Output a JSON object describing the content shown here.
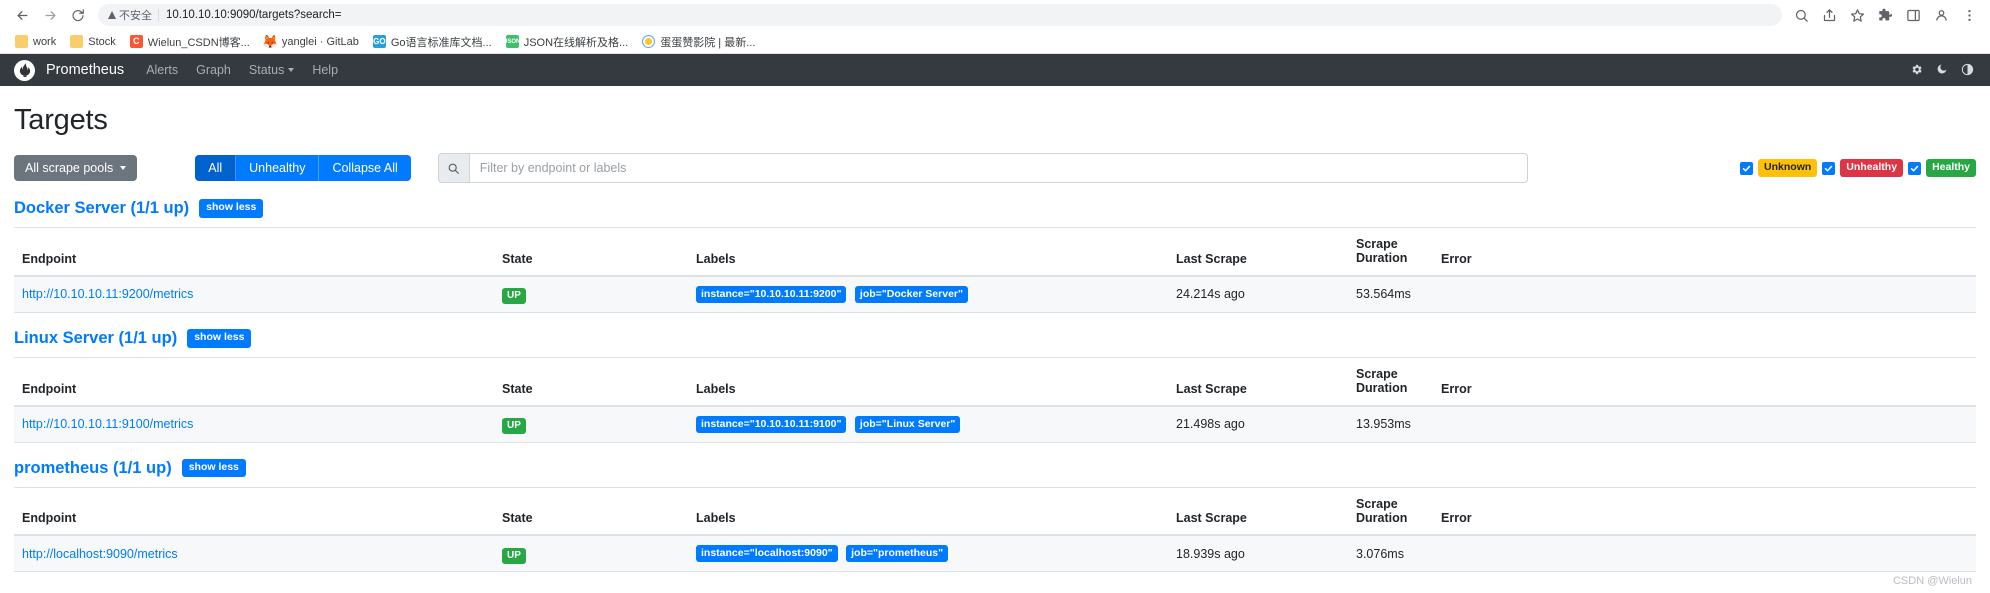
{
  "browser": {
    "back_icon": "back-arrow-icon",
    "forward_icon": "forward-arrow-icon",
    "reload_icon": "reload-icon",
    "security_label": "不安全",
    "url": "10.10.10.10:9090/targets?search=",
    "toolbar_icons": [
      "search-icon",
      "share-icon",
      "star-icon",
      "extensions-icon",
      "sidepanel-icon",
      "profile-icon",
      "menu-icon"
    ],
    "bookmarks": [
      {
        "label": "work",
        "icon": "folder-icon"
      },
      {
        "label": "Stock",
        "icon": "folder-icon"
      },
      {
        "label": "Wielun_CSDN博客...",
        "icon": "csdn-icon"
      },
      {
        "label": "yanglei · GitLab",
        "icon": "gitlab-icon"
      },
      {
        "label": "Go语言标准库文档...",
        "icon": "go-icon"
      },
      {
        "label": "JSON在线解析及格...",
        "icon": "json-icon"
      },
      {
        "label": "蛋蛋赞影院 | 最新...",
        "icon": "movie-icon"
      }
    ]
  },
  "navbar": {
    "brand": "Prometheus",
    "logo_icon": "prometheus-logo-icon",
    "links": [
      {
        "label": "Alerts",
        "caret": false
      },
      {
        "label": "Graph",
        "caret": false
      },
      {
        "label": "Status",
        "caret": true
      },
      {
        "label": "Help",
        "caret": false
      }
    ],
    "right_icons": [
      "gear-icon",
      "moon-icon",
      "contrast-icon"
    ]
  },
  "page": {
    "title": "Targets",
    "watermark": "CSDN @Wielun"
  },
  "toolbar": {
    "scrape_pool_label": "All scrape pools",
    "buttons": [
      {
        "label": "All",
        "active": true
      },
      {
        "label": "Unhealthy",
        "active": false
      },
      {
        "label": "Collapse All",
        "active": false
      }
    ],
    "search_placeholder": "Filter by endpoint or labels",
    "search_value": "",
    "search_icon": "search-icon",
    "status_filters": [
      {
        "label": "Unknown",
        "checked": true,
        "color": "#ffc107",
        "style": "pill-unknown"
      },
      {
        "label": "Unhealthy",
        "checked": true,
        "color": "#dc3545",
        "style": "pill-unhealthy"
      },
      {
        "label": "Healthy",
        "checked": true,
        "color": "#28a745",
        "style": "pill-healthy"
      }
    ]
  },
  "columns": [
    "Endpoint",
    "State",
    "Labels",
    "Last Scrape",
    "Scrape Duration",
    "Error"
  ],
  "pools": [
    {
      "title": "Docker Server (1/1 up)",
      "toggle_label": "show less",
      "rows": [
        {
          "endpoint": "http://10.10.10.11:9200/metrics",
          "state": "UP",
          "labels": [
            "instance=\"10.10.10.11:9200\"",
            "job=\"Docker Server\""
          ],
          "last_scrape": "24.214s ago",
          "duration": "53.564ms",
          "error": ""
        }
      ]
    },
    {
      "title": "Linux Server (1/1 up)",
      "toggle_label": "show less",
      "rows": [
        {
          "endpoint": "http://10.10.10.11:9100/metrics",
          "state": "UP",
          "labels": [
            "instance=\"10.10.10.11:9100\"",
            "job=\"Linux Server\""
          ],
          "last_scrape": "21.498s ago",
          "duration": "13.953ms",
          "error": ""
        }
      ]
    },
    {
      "title": "prometheus (1/1 up)",
      "toggle_label": "show less",
      "rows": [
        {
          "endpoint": "http://localhost:9090/metrics",
          "state": "UP",
          "labels": [
            "instance=\"localhost:9090\"",
            "job=\"prometheus\""
          ],
          "last_scrape": "18.939s ago",
          "duration": "3.076ms",
          "error": ""
        }
      ]
    }
  ]
}
